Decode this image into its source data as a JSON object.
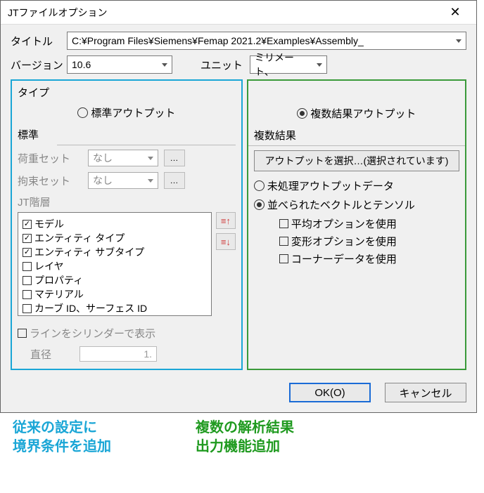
{
  "titlebar": {
    "title": "JTファイルオプション"
  },
  "fields": {
    "title_label": "タイトル",
    "title_value": "C:¥Program Files¥Siemens¥Femap 2021.2¥Examples¥Assembly_",
    "version_label": "バージョン",
    "version_value": "10.6",
    "unit_label": "ユニット",
    "unit_value": "ミリメート、"
  },
  "left": {
    "type_header": "タイプ",
    "radio_standard": "標準アウトプット",
    "standard_header": "標準",
    "load_set_label": "荷重セット",
    "load_set_value": "なし",
    "constraint_set_label": "拘束セット",
    "constraint_set_value": "なし",
    "hierarchy_label": "JT階層",
    "tree": [
      {
        "label": "モデル",
        "checked": true
      },
      {
        "label": "エンティティ タイプ",
        "checked": true
      },
      {
        "label": "エンティティ サブタイプ",
        "checked": true
      },
      {
        "label": "レイヤ",
        "checked": false
      },
      {
        "label": "プロパティ",
        "checked": false
      },
      {
        "label": "マテリアル",
        "checked": false
      },
      {
        "label": "カーブ ID、サーフェス ID",
        "checked": false
      }
    ],
    "cylinder_check": "ラインをシリンダーで表示",
    "diameter_label": "直径",
    "diameter_value": "1."
  },
  "right": {
    "radio_multi": "複数結果アウトプット",
    "multi_header": "複数結果",
    "select_output_btn": "アウトプットを選択…(選択されています)",
    "raw_output": "未処理アウトプットデータ",
    "vectors_tensors": "並べられたベクトルとテンソル",
    "use_avg": "平均オプションを使用",
    "use_deform": "変形オプションを使用",
    "use_corner": "コーナーデータを使用"
  },
  "buttons": {
    "ok": "OK(O)",
    "cancel": "キャンセル"
  },
  "captions": {
    "left_l1": "従来の設定に",
    "left_l2": "境界条件を追加",
    "right_l1": "複数の解析結果",
    "right_l2": "出力機能追加"
  }
}
